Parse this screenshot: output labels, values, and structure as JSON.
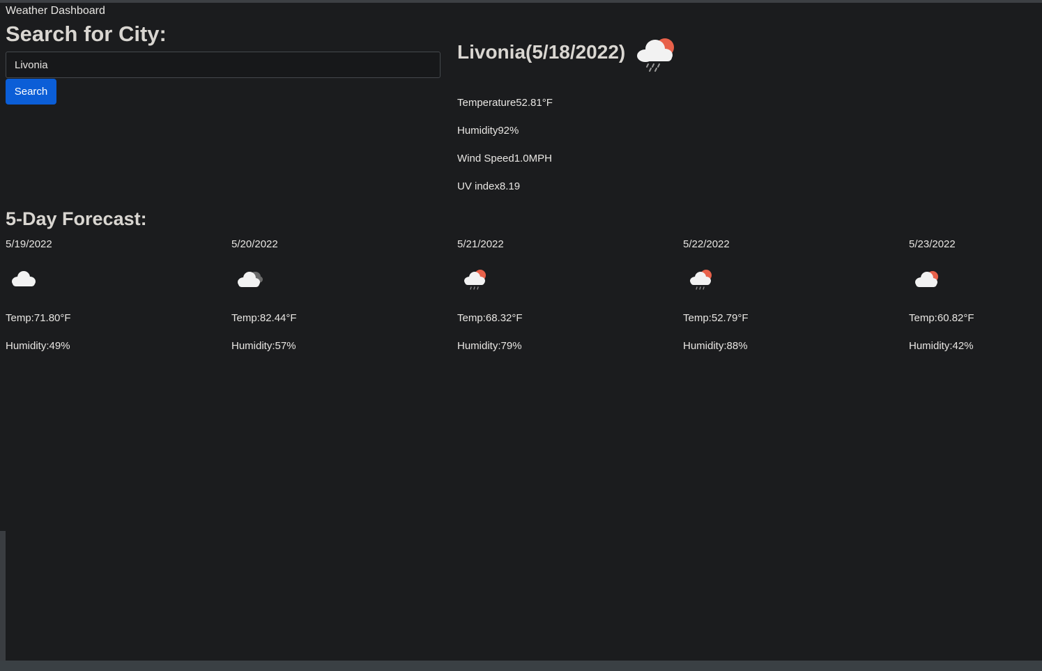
{
  "app": {
    "title": "Weather Dashboard"
  },
  "search": {
    "heading": "Search for City:",
    "input_value": "Livonia",
    "button_label": "Search"
  },
  "current": {
    "title": "Livonia(5/18/2022)",
    "icon": "cloud-sun-rain-icon",
    "temperature": "Temperature52.81°F",
    "humidity": "Humidity92%",
    "wind": "Wind Speed1.0MPH",
    "uv": "UV index8.19"
  },
  "forecast": {
    "heading": "5-Day Forecast:",
    "days": [
      {
        "date": "5/19/2022",
        "icon": "cloud-icon",
        "temp": "Temp:71.80°F",
        "humidity": "Humidity:49%"
      },
      {
        "date": "5/20/2022",
        "icon": "broken-clouds-icon",
        "temp": "Temp:82.44°F",
        "humidity": "Humidity:57%"
      },
      {
        "date": "5/21/2022",
        "icon": "cloud-sun-rain-icon",
        "temp": "Temp:68.32°F",
        "humidity": "Humidity:79%"
      },
      {
        "date": "5/22/2022",
        "icon": "cloud-sun-rain-icon",
        "temp": "Temp:52.79°F",
        "humidity": "Humidity:88%"
      },
      {
        "date": "5/23/2022",
        "icon": "cloud-sun-icon",
        "temp": "Temp:60.82°F",
        "humidity": "Humidity:42%"
      }
    ]
  },
  "colors": {
    "background": "#1b1c1e",
    "accent": "#0b5ed7",
    "sun": "#e8614a"
  }
}
